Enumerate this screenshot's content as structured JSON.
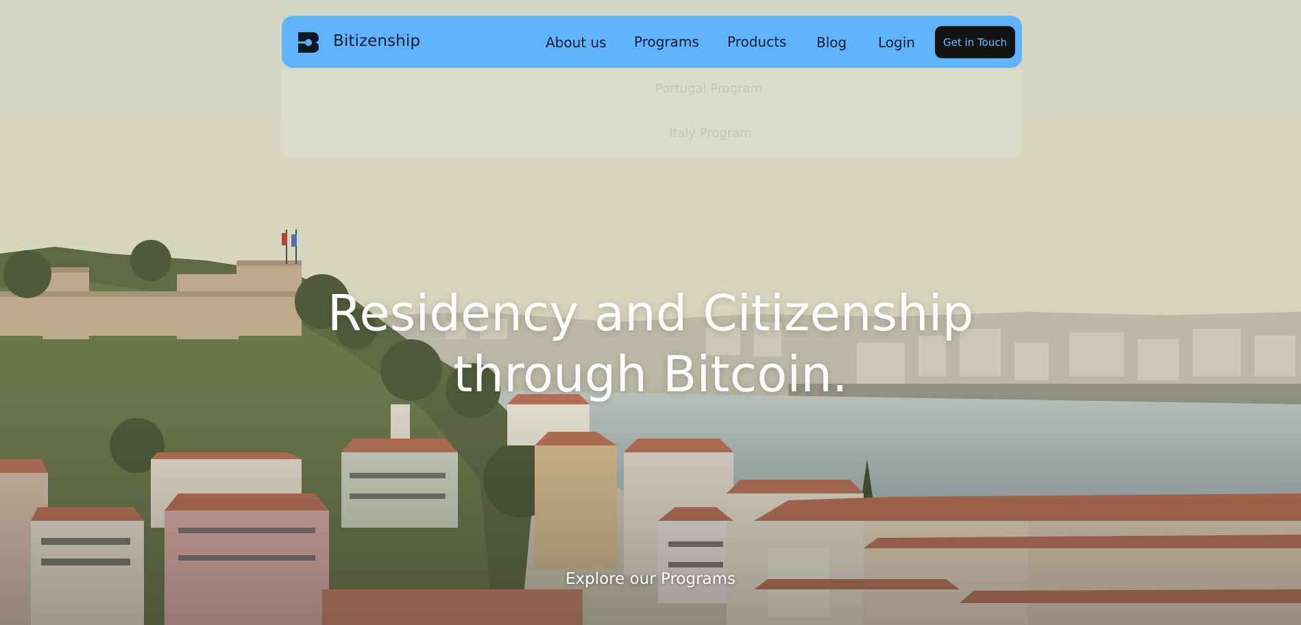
{
  "header": {
    "brand": "Bitizenship",
    "nav": [
      "About us",
      "Programs",
      "Products",
      "Blog",
      "Login"
    ],
    "cta": "Get in Touch"
  },
  "dropdown": {
    "items": [
      "Portugal Program",
      "Italy Program"
    ]
  },
  "hero": {
    "headline_line1": "Residency and Citizenship",
    "headline_line2": "through Bitcoin.",
    "explore": "Explore our Programs"
  },
  "colors": {
    "nav_bg": "#60b4ff",
    "cta_bg": "#151515",
    "cta_text": "#6fb9ff",
    "sky": "#d6d8c2",
    "water": "#a9b7b9",
    "roofs": "#b5654a"
  }
}
